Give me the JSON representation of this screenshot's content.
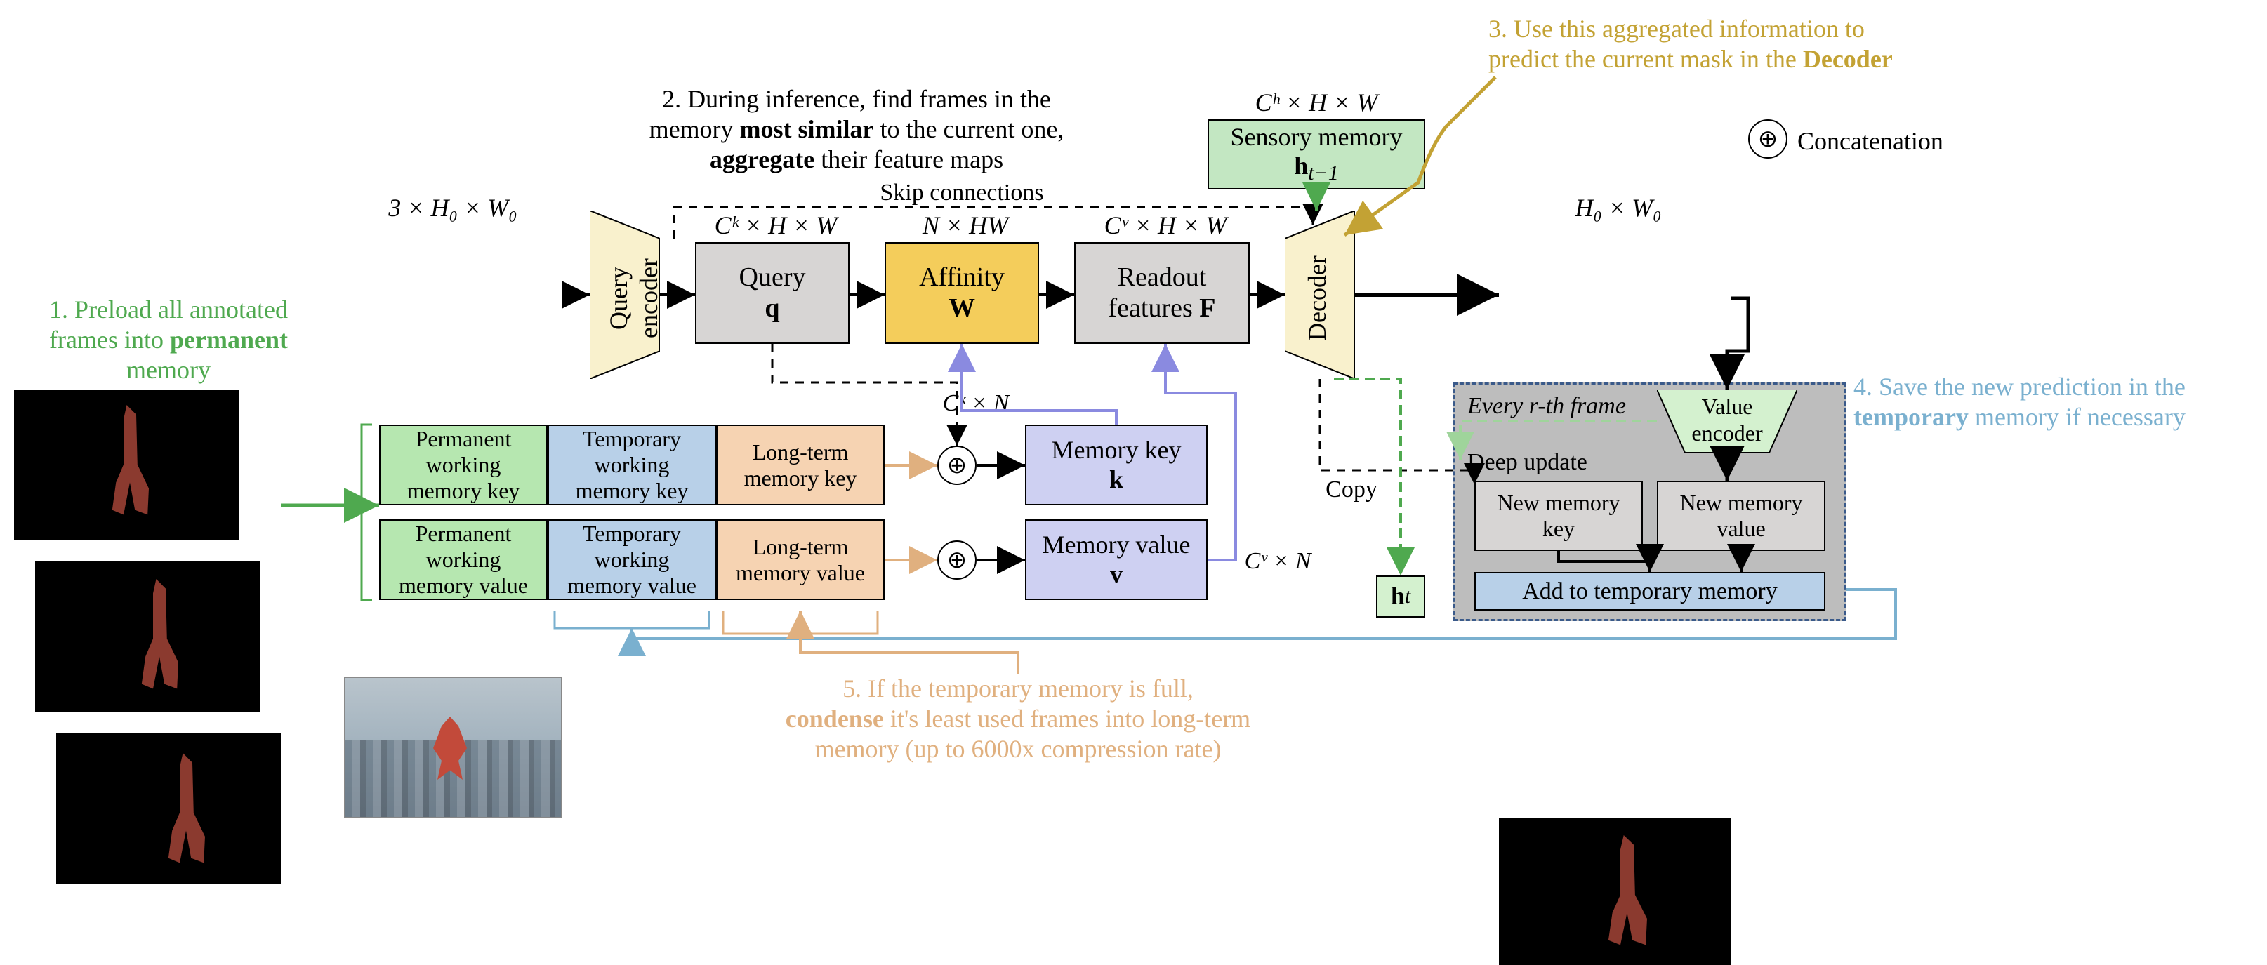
{
  "legend": {
    "concat": "Concatenation"
  },
  "steps": {
    "s1": {
      "l1": "1. Preload all annotated",
      "l2": "frames into ",
      "l2b": "permanent",
      "l3": "memory"
    },
    "s2": {
      "l1": "2. During inference, find frames in the",
      "l2a": "memory ",
      "l2b": "most similar",
      "l2c": " to the current one,",
      "l3b": "aggregate",
      "l3c": " their feature maps"
    },
    "s3": {
      "l1": "3. Use this aggregated information to",
      "l2a": "predict the current mask in the ",
      "l2b": "Decoder"
    },
    "s4": {
      "l1": "4. Save the new prediction in the",
      "l2b": "temporary",
      "l2c": " memory if necessary"
    },
    "s5": {
      "l1": "5. If the temporary memory is full,",
      "l2b": "condense",
      "l2c": " it's least used frames into long-term",
      "l3": "memory (up to 6000x compression rate)"
    }
  },
  "dims": {
    "input": "3 × H₀ × W₀",
    "query": "Cᵏ × H × W",
    "affinity": "N × HW",
    "readout": "Cᵛ × H × W",
    "sensory": "Cʰ × H × W",
    "output": "H₀ × W₀",
    "memkey": "Cᵏ × N",
    "memval": "Cᵛ × N"
  },
  "blocks": {
    "qenc": "Query\nencoder",
    "query": {
      "l1": "Query",
      "l2": "q"
    },
    "aff": {
      "l1": "Affinity",
      "l2": "W"
    },
    "readout": {
      "l1": "Readout",
      "l2": "features ",
      "l2b": "F"
    },
    "decoder": "Decoder",
    "sensory": {
      "l1": "Sensory memory",
      "l2": "h",
      "sub": "t−1"
    },
    "memkey": {
      "l1": "Memory key",
      "l2": "k"
    },
    "memval": {
      "l1": "Memory value",
      "l2": "v"
    },
    "skip": "Skip connections",
    "copy": "Copy",
    "ht": {
      "l": "h",
      "sub": "t"
    }
  },
  "mem": {
    "pwk": "Permanent\nworking\nmemory key",
    "twk": "Temporary\nworking\nmemory key",
    "ltk": "Long-term\nmemory key",
    "pwv": "Permanent\nworking\nmemory value",
    "twv": "Temporary\nworking\nmemory value",
    "ltv": "Long-term\nmemory value"
  },
  "panel": {
    "every": "Every r-th frame",
    "venc": "Value\nencoder",
    "deep": "Deep update",
    "newkey": "New memory\nkey",
    "newval": "New memory\nvalue",
    "add": "Add to temporary memory"
  }
}
